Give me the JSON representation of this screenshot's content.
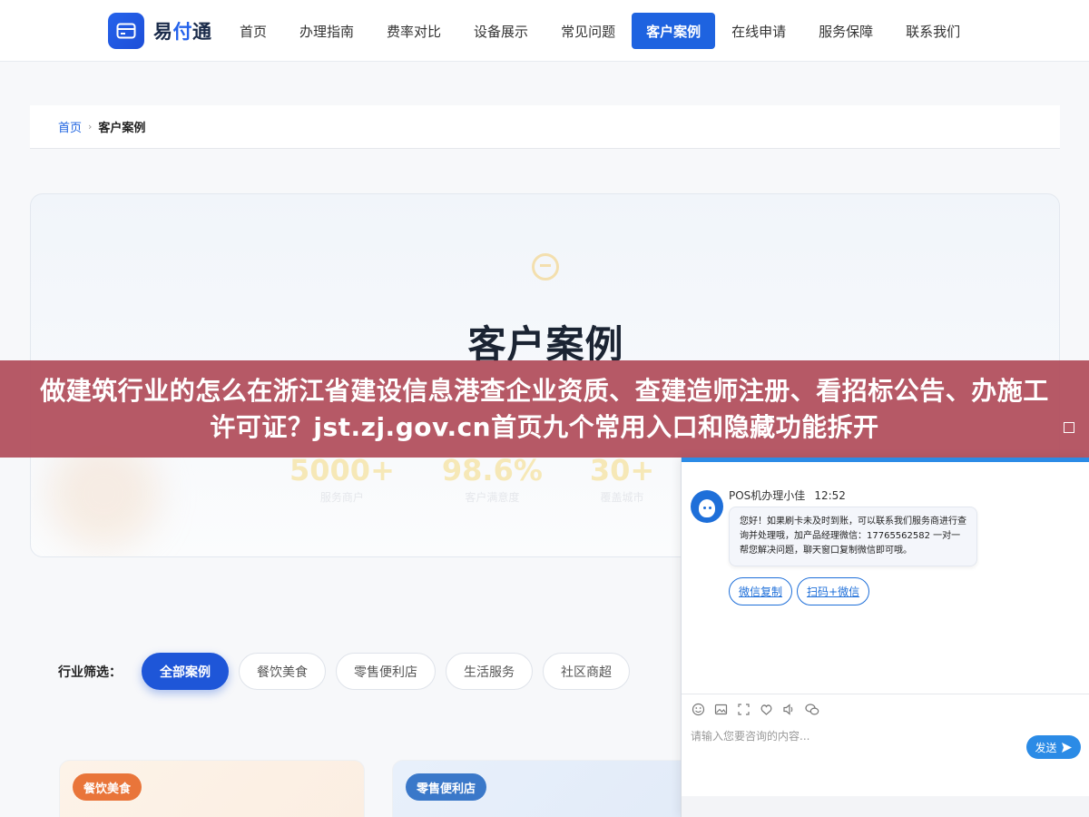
{
  "header": {
    "logo": {
      "prefix": "易",
      "accent": "付",
      "suffix": "通"
    },
    "nav": [
      "首页",
      "办理指南",
      "费率对比",
      "设备展示",
      "常见问题",
      "客户案例",
      "在线申请",
      "服务保障",
      "联系我们"
    ],
    "active_nav": "客户案例"
  },
  "breadcrumb": {
    "home": "首页",
    "separator": "›",
    "current": "客户案例"
  },
  "hero": {
    "title": "客户案例",
    "stats": [
      {
        "value": "5000+",
        "label": "服务商户"
      },
      {
        "value": "98.6%",
        "label": "客户满意度"
      },
      {
        "value": "30+",
        "label": "覆盖城市"
      }
    ]
  },
  "filter": {
    "label": "行业筛选：",
    "chips": [
      "全部案例",
      "餐饮美食",
      "零售便利店",
      "生活服务",
      "社区商超"
    ],
    "active": "全部案例"
  },
  "cards": [
    {
      "tag": "餐饮美食"
    },
    {
      "tag": "零售便利店"
    }
  ],
  "banner": {
    "text": "做建筑行业的怎么在浙江省建设信息港查企业资质、查建造师注册、看招标公告、办施工许可证？jst.zj.gov.cn首页九个常用入口和隐藏功能拆开"
  },
  "chat": {
    "sender": "POS机办理小佳",
    "time": "12:52",
    "message": "您好！如果刷卡未及时到账，可以联系我们服务商进行查询并处理哦，加产品经理微信：17765562582 一对一帮您解决问题，聊天窗口复制微信即可哦。",
    "quick_replies": [
      "微信复制",
      "扫码+微信"
    ],
    "input_placeholder": "请输入您要咨询的内容...",
    "send_label": "发送",
    "toolbar_icons": [
      "emoji-icon",
      "image-icon",
      "screenshot-icon",
      "rate-icon",
      "voice-icon",
      "wechat-icon"
    ]
  },
  "colors": {
    "primary": "#1e63e0",
    "banner_bg": "#b2505e",
    "chat_accent": "#2b8be6"
  }
}
